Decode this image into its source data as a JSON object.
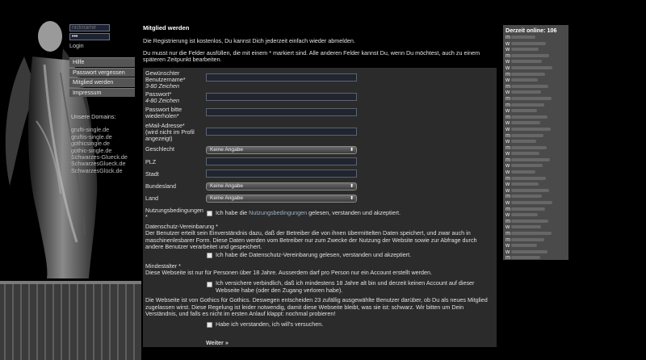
{
  "login": {
    "nickname_placeholder": "nickname",
    "password_value": "•••",
    "login_label": "Login"
  },
  "menu": {
    "items": [
      {
        "label": "Hilfe"
      },
      {
        "label": "Passwort vergessen"
      },
      {
        "label": "Mitglied werden"
      },
      {
        "label": "Impressum"
      }
    ]
  },
  "domains": {
    "title": "Unsere Domains:",
    "links": [
      "grufti-single.de",
      "gruftis-single.de",
      "gothicsingle.de",
      "gothic-single.de",
      "Schwarzes-Glueck.de",
      "SchwarzesGlueck.de",
      "SchwarzesGlück.de"
    ]
  },
  "main": {
    "title": "Mitglied werden",
    "intro": "Die Registrierung ist kostenlos, Du kannst Dich jederzeit einfach wieder abmelden.",
    "intro2": "Du musst nur die Felder ausfüllen, die mit einem * markiert sind. Alle anderen Felder kannst Du, wenn Du möchtest, auch zu einem späteren Zeitpunkt bearbeiten."
  },
  "form": {
    "username_label": "Gewünschter Benutzername*",
    "username_hint": "3-80 Zeichen",
    "password_label": "Passwort*",
    "password_hint": "4-80 Zeichen",
    "password_repeat_label": "Passwort bitte wiederholen*",
    "email_label": "eMail-Adresse*",
    "email_hint": "(wird nicht im Profil angezeigt)",
    "gender_label": "Geschlecht",
    "gender_value": "Keine Angabe",
    "zip_label": "PLZ",
    "city_label": "Stadt",
    "state_label": "Bundesland",
    "state_value": "Keine Angabe",
    "country_label": "Land",
    "country_value": "Keine Angabe",
    "terms_label": "Nutzungsbedingungen *",
    "terms_text_pre": "Ich habe die ",
    "terms_link": "Nutzungsbedingungen",
    "terms_text_post": " gelesen, verstanden und akzeptiert.",
    "privacy_title": "Datenschutz-Vereinbarung *",
    "privacy_text": "Der Benutzer erteilt sein Einverständnis dazu, daß der Betreiber die von ihnen übermittelten Daten speichert, und zwar auch in maschinenlesbarer Form. Diese Daten werden vom Betreiber nur zum Zwecke der Nutzung der Website sowie zur Abfrage durch andere Benutzer verarbeitet und gespeichert.",
    "privacy_check": "Ich habe die Datenschutz-Vereinbarung gelesen, verstanden und akzeptiert.",
    "age_title": "Mindestalter *",
    "age_text": "Diese Webseite ist nur für Personen über 18 Jahre. Ausserdem darf pro Person nur ein Account erstellt werden.",
    "age_check": "Ich versichere verbindlich, daß ich mindestens 18 Jahre alt bin und derzeit keinen Account auf dieser Webseite habe (oder den Zugang verloren habe).",
    "gothic_text": "Die Webseite ist von Gothics für Gothics. Deswegen entscheiden 23 zufällig ausgewählte Benutzer darüber, ob Du als neues Mitglied zugelassen wirst. Diese Regelung ist leider notwendig, damit diese Webseite bleibt, was sie ist: schwarz. Wir bitten um Dein Verständnis, und falls es nicht im ersten Anlauf klappt: nochmal probieren!",
    "gothic_check": "Habe ich verstanden, ich will's versuchen.",
    "submit_label": "Weiter »"
  },
  "online": {
    "title": "Derzeit online: 106",
    "genders": [
      "m",
      "w",
      "w",
      "m",
      "w",
      "w",
      "m",
      "w",
      "m",
      "w",
      "m",
      "m",
      "w",
      "m",
      "w",
      "w",
      "m",
      "w",
      "m",
      "w",
      "m",
      "w",
      "w",
      "m",
      "w",
      "w",
      "m",
      "w",
      "m",
      "w",
      "m",
      "w",
      "m",
      "m",
      "w",
      "w",
      "m"
    ]
  }
}
